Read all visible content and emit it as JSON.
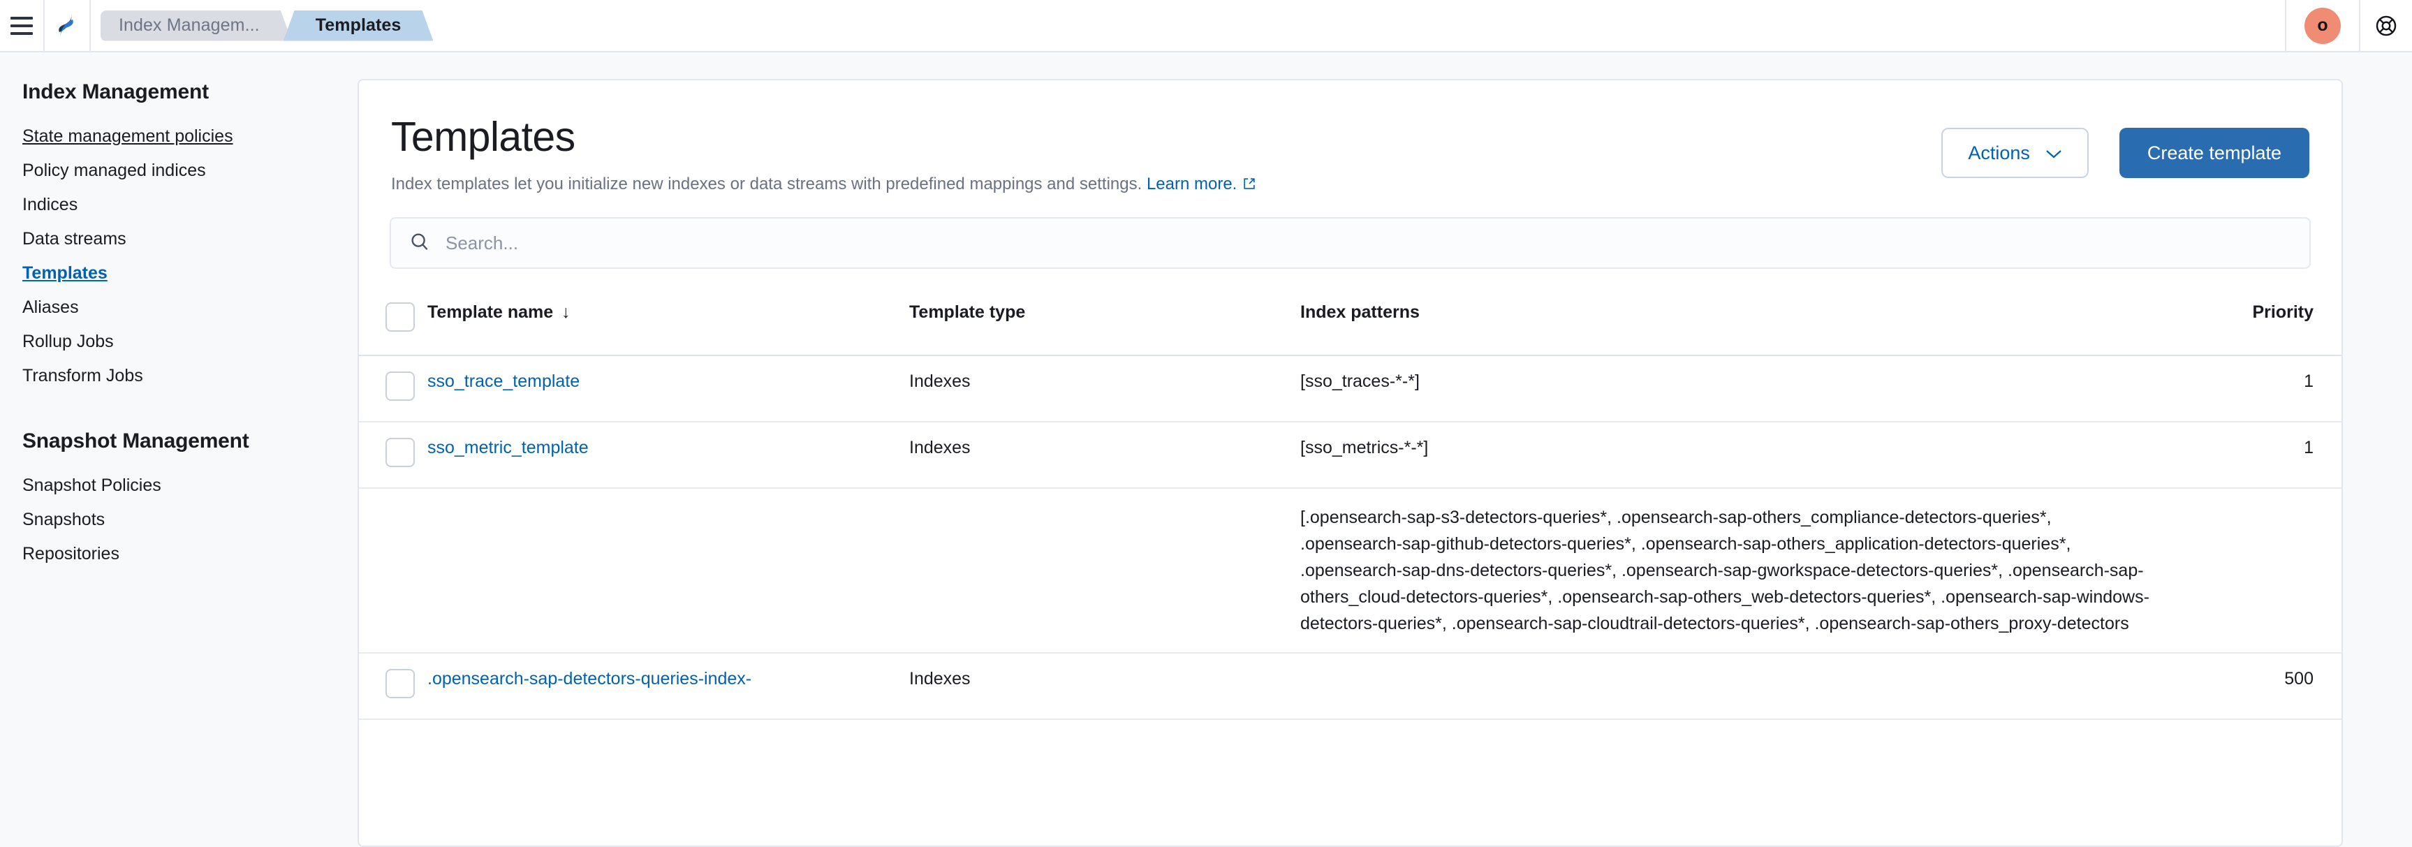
{
  "topnav": {
    "menu_icon": "hamburger-menu-icon",
    "logo_icon": "opensearch-logo-icon",
    "breadcrumbs": [
      {
        "label": "Index Managem...",
        "active": false
      },
      {
        "label": "Templates",
        "active": true
      }
    ],
    "avatar_initial": "o",
    "avatar_color": "#f08c73",
    "help_icon": "lifebuoy-help-icon"
  },
  "sidebar": {
    "groups": [
      {
        "heading": "Index Management",
        "items": [
          {
            "label": "State management policies",
            "state": "hovered"
          },
          {
            "label": "Policy managed indices",
            "state": "normal"
          },
          {
            "label": "Indices",
            "state": "normal"
          },
          {
            "label": "Data streams",
            "state": "normal"
          },
          {
            "label": "Templates",
            "state": "active"
          },
          {
            "label": "Aliases",
            "state": "normal"
          },
          {
            "label": "Rollup Jobs",
            "state": "normal"
          },
          {
            "label": "Transform Jobs",
            "state": "normal"
          }
        ]
      },
      {
        "heading": "Snapshot Management",
        "items": [
          {
            "label": "Snapshot Policies",
            "state": "normal"
          },
          {
            "label": "Snapshots",
            "state": "normal"
          },
          {
            "label": "Repositories",
            "state": "normal"
          }
        ]
      }
    ]
  },
  "main": {
    "title": "Templates",
    "description": "Index templates let you initialize new indexes or data streams with predefined mappings and settings.",
    "learn_more": "Learn more.",
    "actions_label": "Actions",
    "create_label": "Create template",
    "search": {
      "placeholder": "Search...",
      "value": "",
      "icon": "search-icon"
    },
    "table": {
      "columns": [
        {
          "key": "name",
          "label": "Template name",
          "sorted": true,
          "sort_arrow": "↓"
        },
        {
          "key": "type",
          "label": "Template type"
        },
        {
          "key": "patterns",
          "label": "Index patterns"
        },
        {
          "key": "priority",
          "label": "Priority"
        }
      ],
      "rows": [
        {
          "name": "sso_trace_template",
          "type": "Indexes",
          "patterns": "[sso_traces-*-*]",
          "priority": "1",
          "checked": false
        },
        {
          "name": "sso_metric_template",
          "type": "Indexes",
          "patterns": "[sso_metrics-*-*]",
          "priority": "1",
          "checked": false
        },
        {
          "name": "",
          "type": "",
          "patterns": "[.opensearch-sap-s3-detectors-queries*, .opensearch-sap-others_compliance-detectors-queries*, .opensearch-sap-github-detectors-queries*, .opensearch-sap-others_application-detectors-queries*, .opensearch-sap-dns-detectors-queries*, .opensearch-sap-gworkspace-detectors-queries*, .opensearch-sap-others_cloud-detectors-queries*, .opensearch-sap-others_web-detectors-queries*, .opensearch-sap-windows-detectors-queries*, .opensearch-sap-cloudtrail-detectors-queries*, .opensearch-sap-others_proxy-detectors",
          "priority": "",
          "checked": false
        },
        {
          "name": ".opensearch-sap-detectors-queries-index-",
          "type": "Indexes",
          "patterns": "",
          "priority": "500",
          "checked": false
        }
      ]
    }
  },
  "colors": {
    "accent": "#0062b1",
    "primary_button": "#2a6cb0",
    "crumb_active": "#b9d3ea",
    "crumb_inactive": "#d9dce3",
    "avatar": "#f08c73"
  }
}
